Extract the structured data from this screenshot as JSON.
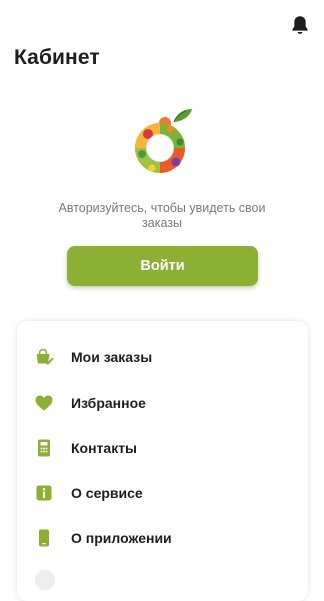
{
  "header": {
    "title": "Кабинет",
    "icons": {
      "notifications": "bell-icon"
    }
  },
  "auth": {
    "message": "Авторизуйтесь, чтобы увидеть свои заказы",
    "login_label": "Войти"
  },
  "menu": {
    "items": [
      {
        "label": "Мои заказы",
        "icon": "basket-check-icon"
      },
      {
        "label": "Избранное",
        "icon": "heart-icon"
      },
      {
        "label": "Контакты",
        "icon": "phone-icon"
      },
      {
        "label": "О сервисе",
        "icon": "info-icon"
      },
      {
        "label": "О приложении",
        "icon": "mobile-icon"
      }
    ]
  },
  "colors": {
    "accent": "#8bb033",
    "text": "#1e1e1e",
    "muted": "#7a7a7a"
  }
}
